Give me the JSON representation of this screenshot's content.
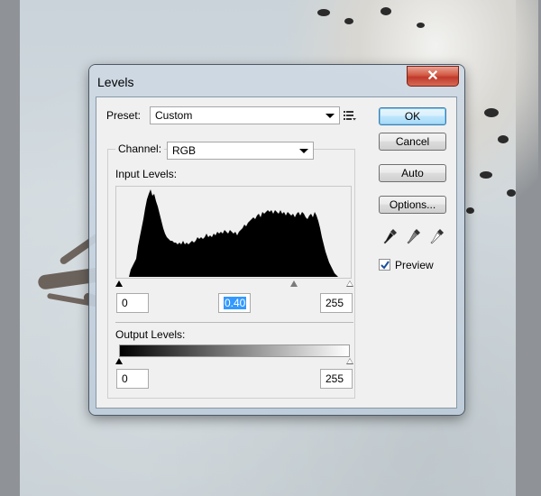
{
  "window": {
    "title": "Levels",
    "close_glyph": "✕"
  },
  "preset": {
    "label": "Preset:",
    "value": "Custom",
    "menu_icon": "preset-options-icon"
  },
  "channel": {
    "label": "Channel:",
    "value": "RGB"
  },
  "input_levels": {
    "label": "Input Levels:",
    "black": "0",
    "gamma": "0.40",
    "white": "255"
  },
  "output_levels": {
    "label": "Output Levels:",
    "black": "0",
    "white": "255"
  },
  "buttons": {
    "ok": "OK",
    "cancel": "Cancel",
    "auto": "Auto",
    "options": "Options..."
  },
  "preview": {
    "label": "Preview",
    "checked": true
  },
  "icons": {
    "black_point": "black-eyedropper-icon",
    "gray_point": "gray-eyedropper-icon",
    "white_point": "white-eyedropper-icon"
  },
  "colors": {
    "selection": "#3399ff",
    "close_red": "#c0392b",
    "default_button_border": "#3c7fb1"
  }
}
